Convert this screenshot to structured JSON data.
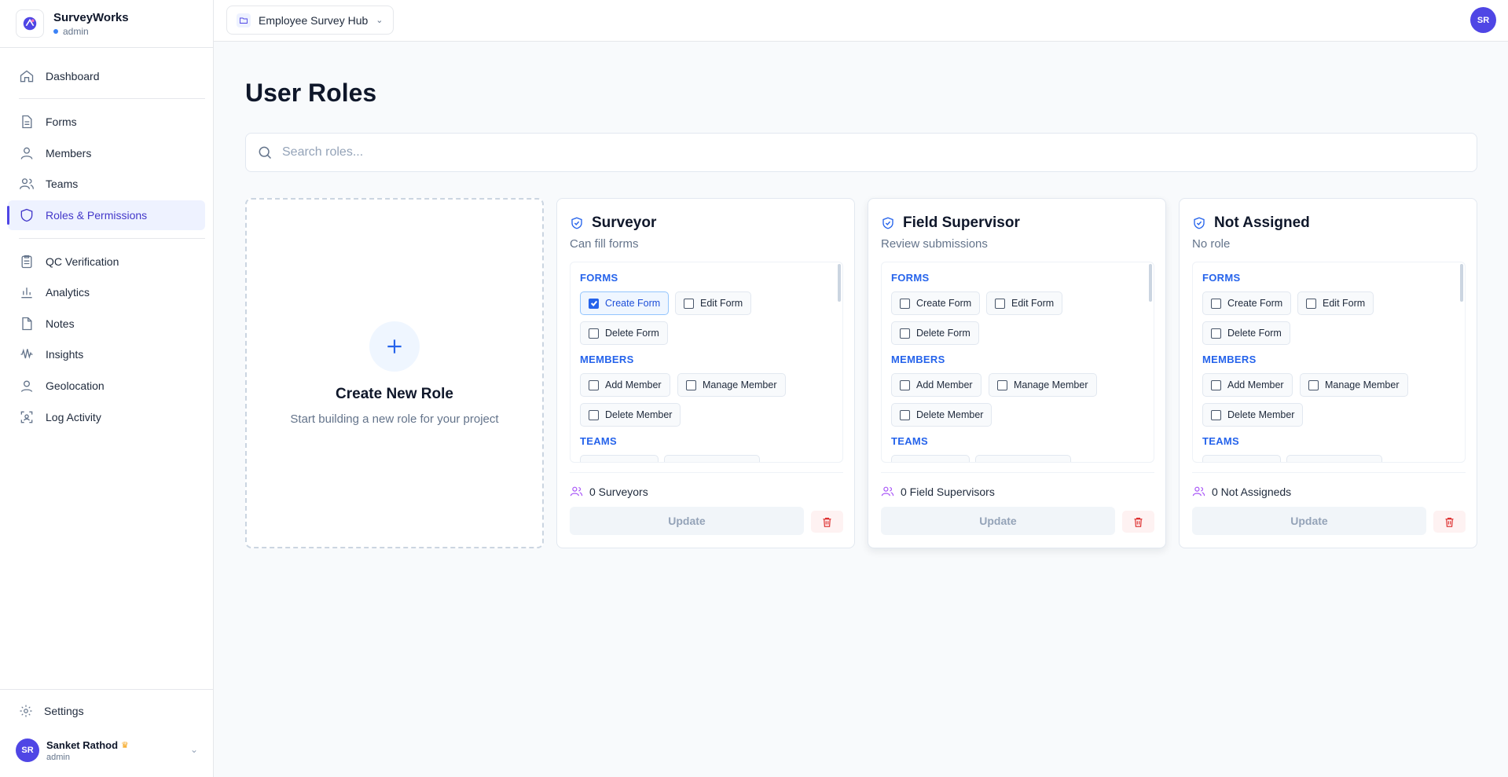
{
  "brand": {
    "name": "SurveyWorks",
    "role": "admin"
  },
  "nav": {
    "items": [
      {
        "label": "Dashboard",
        "icon": "home-icon"
      },
      {
        "label": "Forms",
        "icon": "file-icon"
      },
      {
        "label": "Members",
        "icon": "user-icon"
      },
      {
        "label": "Teams",
        "icon": "users-icon"
      },
      {
        "label": "Roles & Permissions",
        "icon": "shield-icon"
      },
      {
        "label": "QC Verification",
        "icon": "clipboard-icon"
      },
      {
        "label": "Analytics",
        "icon": "bar-chart-icon"
      },
      {
        "label": "Notes",
        "icon": "note-icon"
      },
      {
        "label": "Insights",
        "icon": "wave-icon"
      },
      {
        "label": "Geolocation",
        "icon": "map-pin-icon"
      },
      {
        "label": "Log Activity",
        "icon": "scan-icon"
      }
    ],
    "active": "Roles & Permissions"
  },
  "settings_label": "Settings",
  "user": {
    "initials": "SR",
    "name": "Sanket Rathod",
    "role": "admin"
  },
  "topbar": {
    "project": "Employee Survey Hub",
    "avatar": "SR"
  },
  "page": {
    "title": "User Roles"
  },
  "search": {
    "placeholder": "Search roles..."
  },
  "create_card": {
    "title": "Create New Role",
    "subtitle": "Start building a new role for your project"
  },
  "perm_groups": {
    "forms": "FORMS",
    "members": "MEMBERS",
    "teams": "TEAMS"
  },
  "permissions": {
    "create_form": "Create Form",
    "edit_form": "Edit Form",
    "delete_form": "Delete Form",
    "add_member": "Add Member",
    "manage_member": "Manage Member",
    "delete_member": "Delete Member"
  },
  "roles": [
    {
      "name": "Surveyor",
      "description": "Can fill forms",
      "count": "0 Surveyors",
      "update": "Update",
      "create_form_checked": true
    },
    {
      "name": "Field Supervisor",
      "description": "Review submissions",
      "count": "0 Field Supervisors",
      "update": "Update",
      "create_form_checked": false
    },
    {
      "name": "Not Assigned",
      "description": "No role",
      "count": "0 Not Assigneds",
      "update": "Update",
      "create_form_checked": false
    }
  ],
  "colors": {
    "accent": "#4f46e5",
    "link": "#2563eb",
    "danger": "#dc2626"
  }
}
